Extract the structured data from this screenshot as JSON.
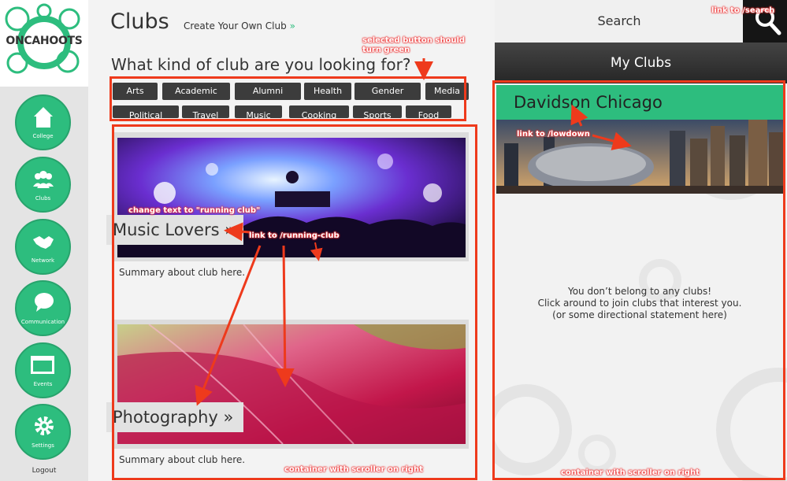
{
  "app": {
    "logo_text": "ONCAHOOTS",
    "colors": {
      "accent": "#2dbd7e",
      "annotation": "#ee3a1c",
      "button_dark": "#3c3c3c"
    }
  },
  "sidebar": {
    "items": [
      {
        "label": "College",
        "icon": "home-icon"
      },
      {
        "label": "Clubs",
        "icon": "people-icon"
      },
      {
        "label": "Network",
        "icon": "handshake-icon"
      },
      {
        "label": "Communication",
        "icon": "chat-bubble-icon"
      },
      {
        "label": "Events",
        "icon": "calendar-icon"
      },
      {
        "label": "Settings",
        "icon": "gear-icon"
      }
    ],
    "logout_label": "Logout"
  },
  "header": {
    "title": "Clubs",
    "create_link": "Create Your Own Club",
    "create_chevron": "»"
  },
  "filter": {
    "question": "What kind of club are you looking for?",
    "row1": [
      "Arts",
      "Academic",
      "Alumni",
      "Health",
      "Gender",
      "Media"
    ],
    "row2": [
      "Political",
      "Travel",
      "Music",
      "Cooking",
      "Sports",
      "Food"
    ]
  },
  "clubs": [
    {
      "name": "Music Lovers »",
      "summary": "Summary about club here."
    },
    {
      "name": "Photography »",
      "summary": "Summary about club here."
    }
  ],
  "search": {
    "label": "Search"
  },
  "my_clubs": {
    "title": "My Clubs",
    "banner_title": "Davidson Chicago",
    "empty_lines": [
      "You don’t belong to any clubs!",
      "Click around to join clubs that interest you.",
      "(or some directional statement here)"
    ]
  },
  "annotations": {
    "link_search": "link to /search",
    "selected_button_1": "selected button should",
    "selected_button_2": "turn green",
    "link_lowdown": "link to /lowdown",
    "change_text": "change text to \"running club\"",
    "link_running_club": "link to /running-club",
    "container_center": "container with scroller on right",
    "container_right": "container with scroller on right"
  }
}
